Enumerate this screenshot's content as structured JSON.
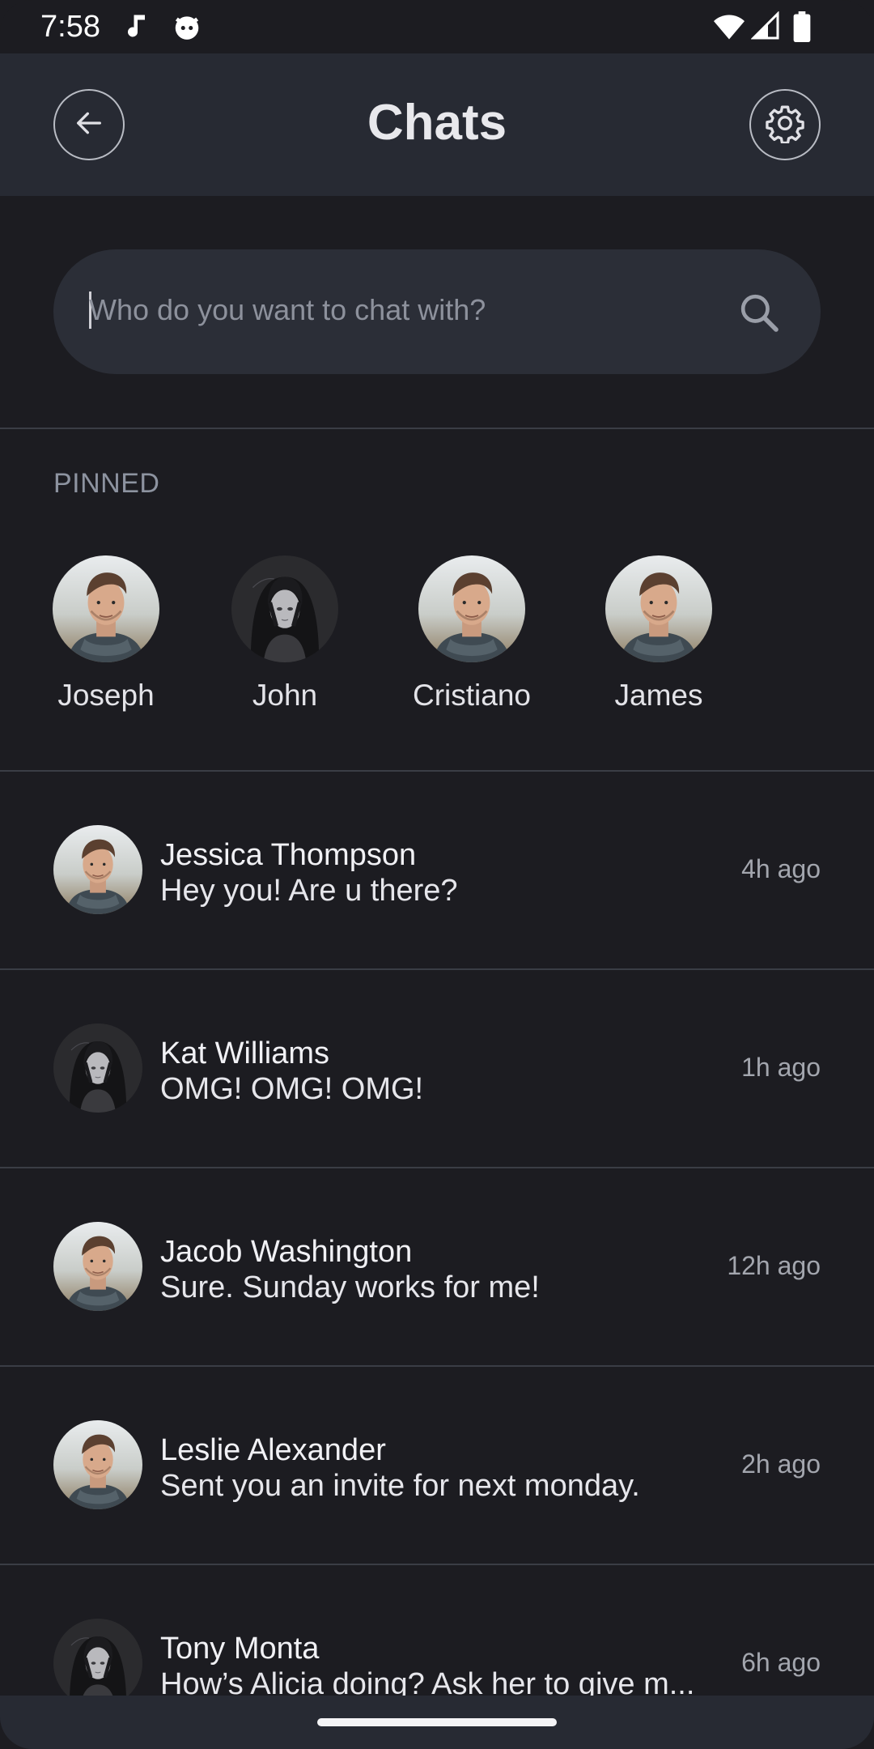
{
  "status_bar": {
    "time": "7:58"
  },
  "app_bar": {
    "title": "Chats"
  },
  "search": {
    "placeholder": "Who do you want to chat with?"
  },
  "pinned": {
    "label": "PINNED",
    "items": [
      {
        "name": "Joseph",
        "avatar": "man-photo"
      },
      {
        "name": "John",
        "avatar": "anime-girl"
      },
      {
        "name": "Cristiano",
        "avatar": "man-photo"
      },
      {
        "name": "James",
        "avatar": "man-photo"
      }
    ]
  },
  "chats": [
    {
      "name": "Jessica Thompson",
      "message": "Hey you! Are u there?",
      "time": "4h ago",
      "avatar": "man-photo"
    },
    {
      "name": "Kat Williams",
      "message": "OMG! OMG! OMG!",
      "time": "1h ago",
      "avatar": "anime-girl"
    },
    {
      "name": "Jacob Washington",
      "message": "Sure. Sunday works for me!",
      "time": "12h ago",
      "avatar": "man-photo"
    },
    {
      "name": "Leslie Alexander",
      "message": "Sent you an invite for next monday.",
      "time": "2h ago",
      "avatar": "man-photo"
    },
    {
      "name": "Tony Monta",
      "message": "How’s Alicia doing? Ask her to give m...",
      "time": "6h ago",
      "avatar": "anime-girl"
    }
  ],
  "colors": {
    "background": "#1c1c21",
    "app_bar": "#272a33",
    "search": "#2b2e37"
  }
}
